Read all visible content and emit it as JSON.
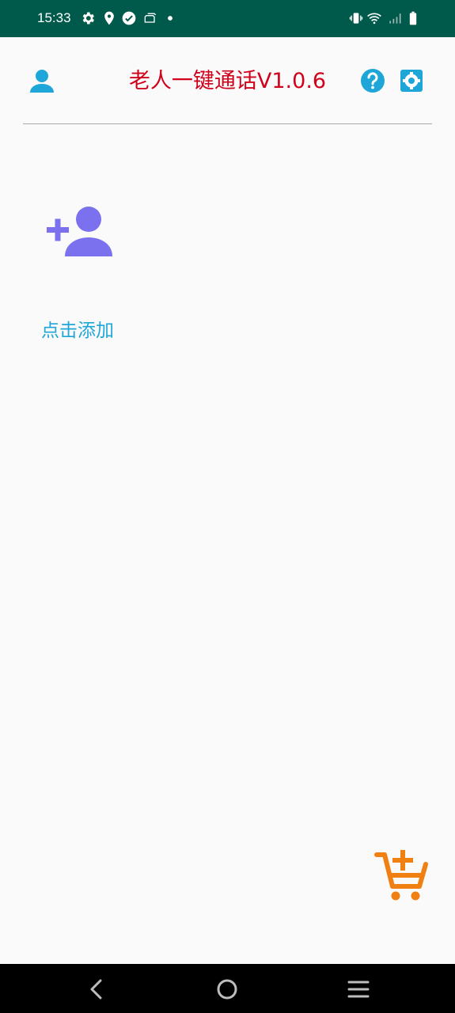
{
  "status_bar": {
    "time": "15:33",
    "icons": [
      "gear-icon",
      "location-pin-icon",
      "check-circle-icon",
      "app-notification-icon",
      "dot-icon",
      "vibrate-icon",
      "wifi-icon",
      "signal-icon",
      "battery-icon"
    ]
  },
  "app_bar": {
    "title": "老人一键通话V1.0.6",
    "left_icon": "person-icon",
    "right_icons": [
      "help-icon",
      "settings-icon"
    ],
    "accent_color": "#1fa6d8",
    "title_color": "#d0021b"
  },
  "main": {
    "add_contact_label": "点击添加",
    "add_contact_icon": "person-add-icon",
    "add_contact_icon_color": "#7b70ee"
  },
  "fab": {
    "icon": "cart-add-icon",
    "color": "#f08012"
  },
  "nav_bar": {
    "buttons": [
      "back-icon",
      "home-icon",
      "menu-icon"
    ]
  }
}
